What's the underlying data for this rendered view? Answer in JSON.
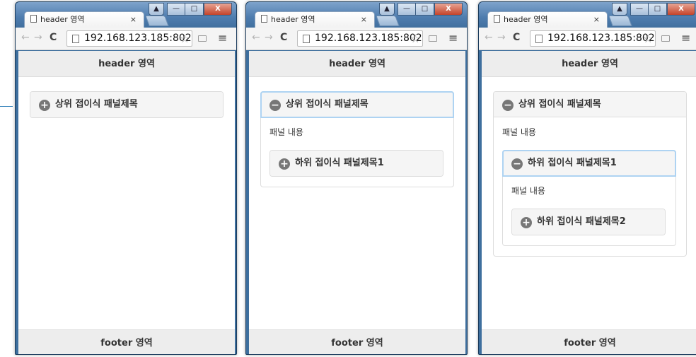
{
  "browser": {
    "tab_title": "header 영역",
    "tab_close": "×",
    "url": "192.168.123.185:802",
    "controls": {
      "lift": "▲",
      "minimize": "—",
      "maximize": "□",
      "close": "X"
    },
    "nav": {
      "back": "←",
      "forward": "→",
      "reload": "C",
      "star": "☆",
      "menu": "≡"
    }
  },
  "page": {
    "header": "header 영역",
    "footer": "footer 영역",
    "panel_content": "패널 내용"
  },
  "accordion": {
    "top_title": "상위 접이식 패널제목",
    "sub_title_1": "하위 접이식 패널제목1",
    "sub_title_2": "하위 접이식 패널제목2"
  },
  "icons": {
    "expand": "+",
    "collapse": "−"
  },
  "colors": {
    "icon_bg": "#777777",
    "panel_heading_bg": "#f5f5f5",
    "focus_border": "#78b3e4",
    "window_frame": "#3e6f9e"
  },
  "states": [
    {
      "state": "collapsed"
    },
    {
      "state": "top-expanded"
    },
    {
      "state": "sub1-expanded"
    }
  ]
}
